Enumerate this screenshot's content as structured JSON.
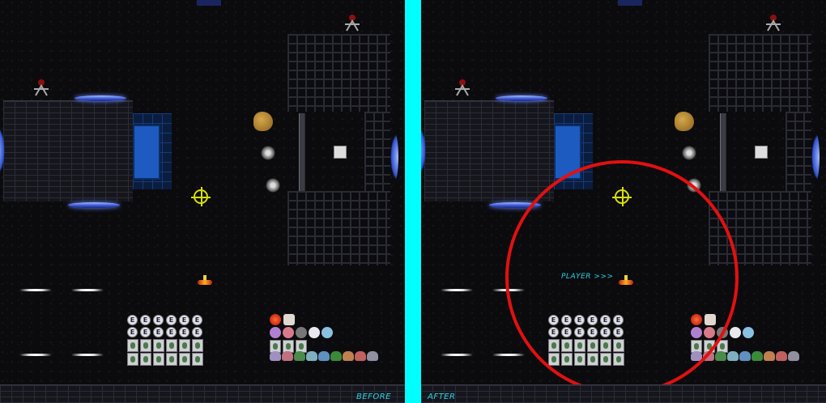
{
  "labels": {
    "before": "BEFORE",
    "after": "AFTER",
    "player": "PLAYER >>>"
  },
  "hud": {
    "badge_letter": "E",
    "badge_count": 6,
    "vial_count": 6
  },
  "colors": {
    "divider": "#00ffff",
    "label": "#29d4e0",
    "highlight_ring": "#e21010",
    "target_reticle": "#d8e000",
    "water": "#1d5bc0"
  },
  "icons": [
    "target-reticle-icon",
    "player-ship-icon",
    "sentry-turret-icon",
    "spiked-mine-icon",
    "asteroid-icon",
    "skull-sign-icon",
    "energy-badge-icon",
    "vial-icon",
    "powerup-orb-icon",
    "creature-icon"
  ]
}
